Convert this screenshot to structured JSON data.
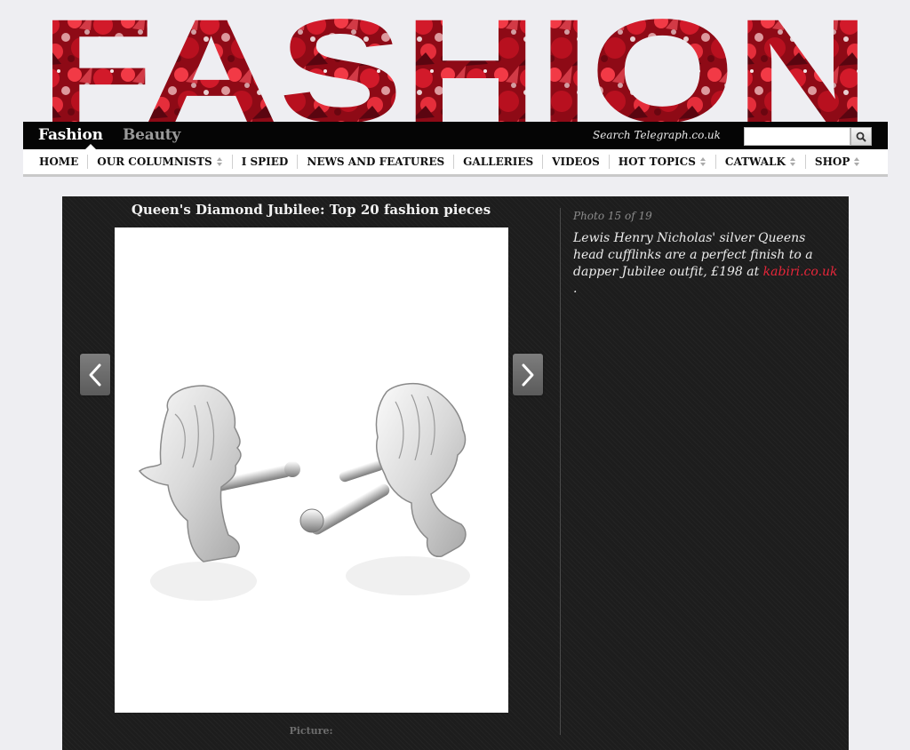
{
  "masthead": {
    "title": "FASHION"
  },
  "section_tabs": [
    {
      "label": "Fashion",
      "active": true
    },
    {
      "label": "Beauty",
      "active": false
    }
  ],
  "search": {
    "label": "Search Telegraph.co.uk",
    "placeholder": "",
    "button_icon": "magnifier-icon"
  },
  "nav": {
    "items": [
      {
        "label": "HOME",
        "dropdown": false
      },
      {
        "label": "OUR COLUMNISTS",
        "dropdown": true
      },
      {
        "label": "I SPIED",
        "dropdown": false
      },
      {
        "label": "NEWS AND FEATURES",
        "dropdown": false
      },
      {
        "label": "GALLERIES",
        "dropdown": false
      },
      {
        "label": "VIDEOS",
        "dropdown": false
      },
      {
        "label": "HOT TOPICS",
        "dropdown": true
      },
      {
        "label": "CATWALK",
        "dropdown": true
      },
      {
        "label": "SHOP",
        "dropdown": true
      }
    ]
  },
  "gallery": {
    "title": "Queen's Diamond Jubilee: Top 20 fashion pieces",
    "counter": "Photo 15 of 19",
    "caption_text": "Lewis Henry Nicholas' silver Queens head cufflinks are a perfect finish to a dapper Jubilee outfit, £198 at ",
    "caption_link": "kabiri.co.uk",
    "caption_end": " .",
    "picture_credit": "Picture:",
    "prev_icon": "chevron-left-icon",
    "next_icon": "chevron-right-icon"
  },
  "colors": {
    "page_bg": "#eeeef2",
    "bar_bg": "#050505",
    "gallery_bg": "#1d1d1d",
    "link_red": "#e6263a",
    "masthead_red": "#b3101e"
  }
}
